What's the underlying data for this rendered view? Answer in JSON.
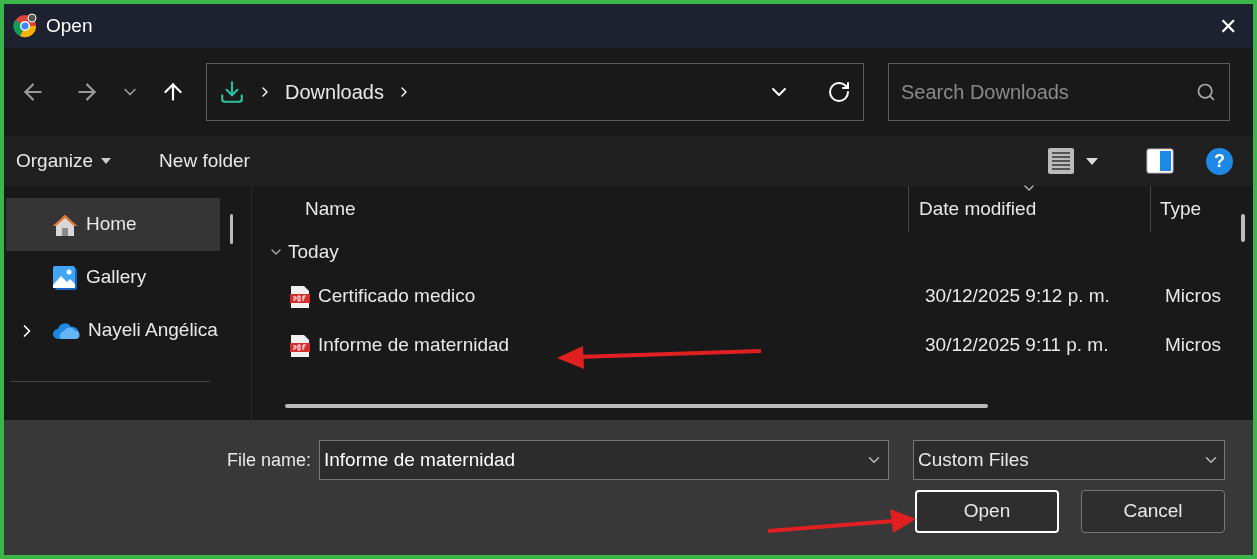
{
  "window": {
    "title": "Open",
    "close": "✕"
  },
  "address": {
    "crumbs": [
      "Downloads"
    ],
    "search_placeholder": "Search Downloads"
  },
  "toolbar": {
    "organize": "Organize",
    "new_folder": "New folder",
    "help": "?"
  },
  "sidebar": {
    "items": [
      {
        "label": "Home",
        "kind": "home",
        "selected": true
      },
      {
        "label": "Gallery",
        "kind": "gallery",
        "selected": false
      },
      {
        "label": "Nayeli Angélica",
        "kind": "cloud",
        "selected": false,
        "expanded": false
      }
    ]
  },
  "table": {
    "columns": [
      "Name",
      "Date modified",
      "Type"
    ],
    "groups": [
      {
        "label": "Today",
        "expanded": true,
        "rows": [
          {
            "name": "Certificado medico",
            "date": "30/12/2025 9:12 p. m.",
            "type": "Micros"
          },
          {
            "name": "Informe de maternidad",
            "date": "30/12/2025 9:11 p. m.",
            "type": "Micros"
          }
        ]
      }
    ]
  },
  "footer": {
    "file_name_label": "File name:",
    "file_name": "Informe de maternidad",
    "filter": "Custom Files",
    "buttons": [
      {
        "label": "Open",
        "selected": true
      },
      {
        "label": "Cancel",
        "selected": false
      }
    ]
  }
}
